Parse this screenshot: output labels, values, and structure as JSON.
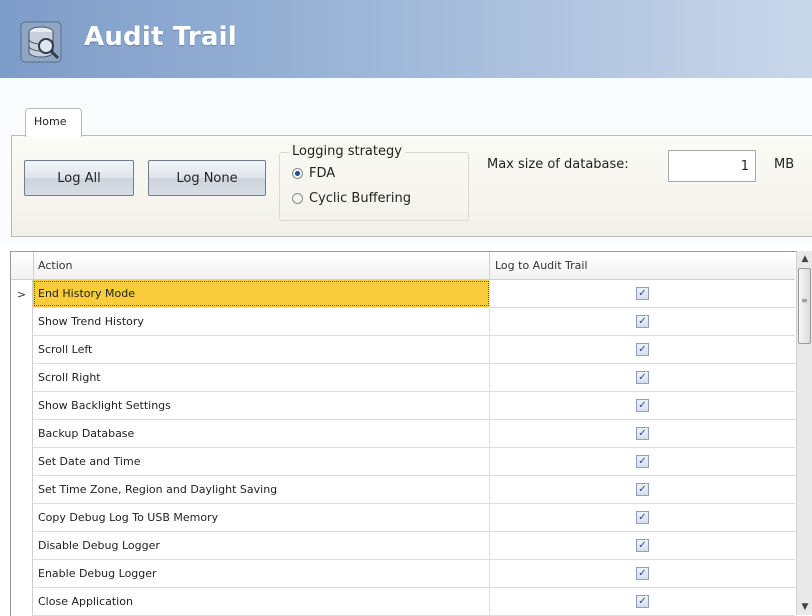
{
  "header": {
    "title": "Audit Trail",
    "icon": "database-icon"
  },
  "ribbon": {
    "tab_label": "Home",
    "log_all_label": "Log All",
    "log_none_label": "Log None",
    "strategy": {
      "legend": "Logging strategy",
      "options": [
        {
          "label": "FDA",
          "selected": true
        },
        {
          "label": "Cyclic Buffering",
          "selected": false
        }
      ]
    },
    "max_size_label": "Max size of database:",
    "max_size_value": "1",
    "max_size_unit": "MB"
  },
  "grid": {
    "columns": [
      "Action",
      "Log to Audit Trail"
    ],
    "current_row_marker": ">",
    "rows": [
      {
        "action": "End History Mode",
        "checked": true,
        "selected": true
      },
      {
        "action": "Show Trend History",
        "checked": true
      },
      {
        "action": "Scroll Left",
        "checked": true
      },
      {
        "action": "Scroll Right",
        "checked": true
      },
      {
        "action": "Show Backlight Settings",
        "checked": true
      },
      {
        "action": "Backup Database",
        "checked": true
      },
      {
        "action": "Set Date and Time",
        "checked": true
      },
      {
        "action": "Set Time Zone, Region and Daylight Saving",
        "checked": true
      },
      {
        "action": "Copy Debug Log To USB Memory",
        "checked": true
      },
      {
        "action": "Disable Debug Logger",
        "checked": true
      },
      {
        "action": "Enable Debug Logger",
        "checked": true
      },
      {
        "action": "Close Application",
        "checked": true
      }
    ]
  },
  "colors": {
    "header_start": "#7d9cc8",
    "header_end": "#c9d7ea",
    "selection": "#f8cc3a"
  }
}
